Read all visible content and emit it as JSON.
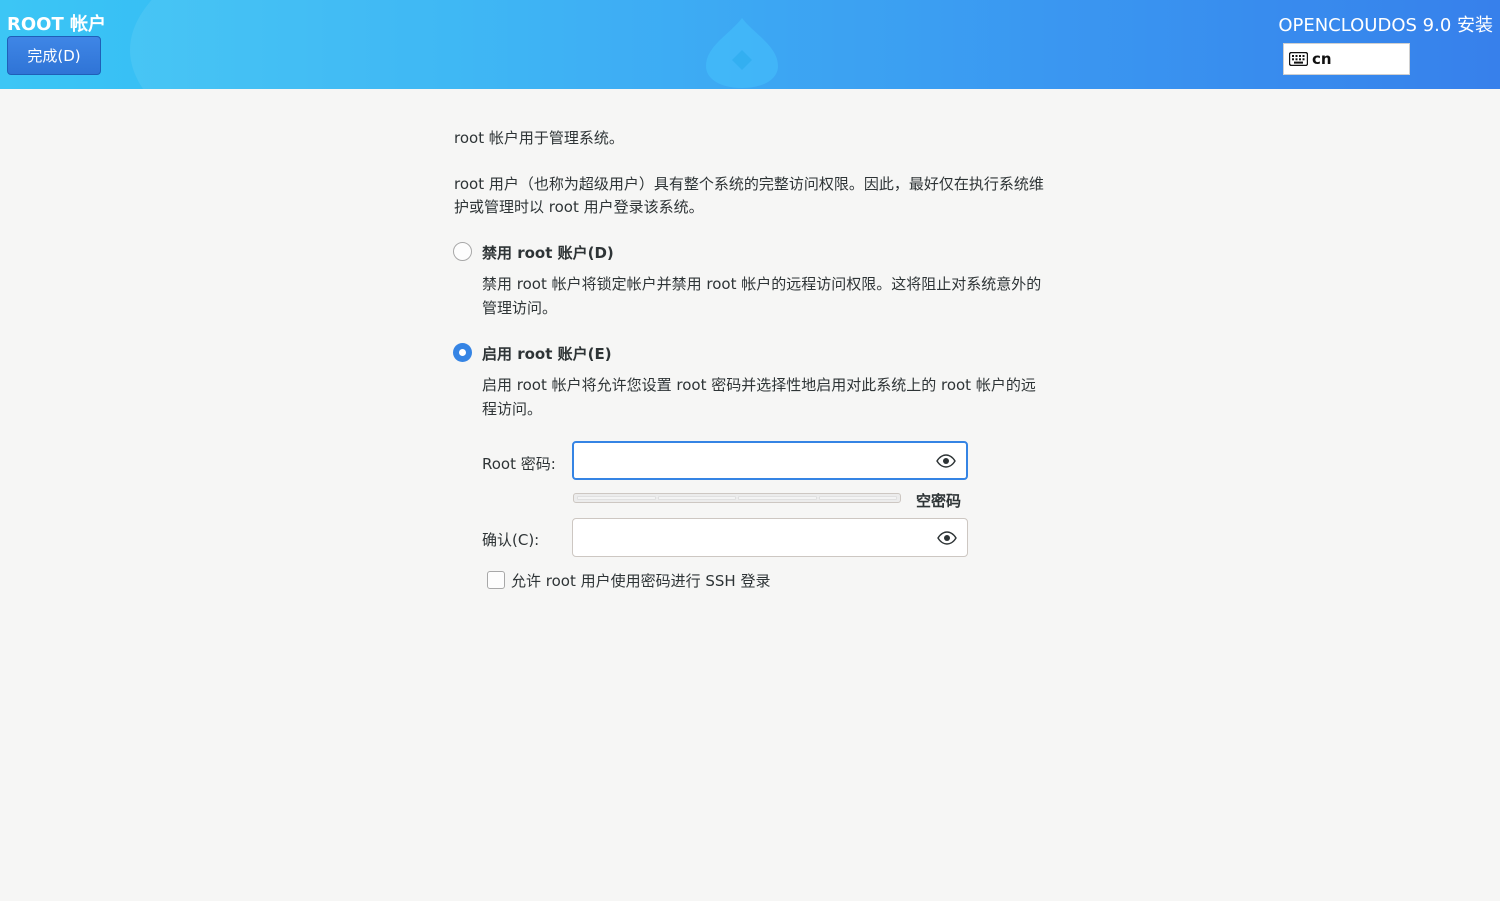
{
  "header": {
    "spoke_title": "ROOT 帐户",
    "done_label": "完成(D)",
    "product_title": "OPENCLOUDOS 9.0 安装",
    "keyboard_layout": "cn"
  },
  "intro": {
    "line1": "root 帐户用于管理系统。",
    "line2a": "root 用户（也称为超级用户）具有整个系统的完整访问权限。因此，最好仅在执行系统维",
    "line2b": "护或管理时以 root 用户登录该系统。"
  },
  "options": {
    "disable": {
      "label": "禁用 root 账户(D)",
      "desc_a": "禁用 root 帐户将锁定帐户并禁用 root 帐户的远程访问权限。这将阻止对系统意外的",
      "desc_b": "管理访问。",
      "selected": false
    },
    "enable": {
      "label": "启用 root 账户(E)",
      "desc_a": "启用 root 帐户将允许您设置 root 密码并选择性地启用对此系统上的 root 帐户的远",
      "desc_b": "程访问。",
      "selected": true
    }
  },
  "form": {
    "password_label": "Root 密码:",
    "password_value": "",
    "strength_label": "空密码",
    "strength_level": 0,
    "confirm_label": "确认(C):",
    "confirm_value": "",
    "ssh_label": "允许 root 用户使用密码进行 SSH 登录",
    "ssh_checked": false
  },
  "colors": {
    "accent": "#3584e4",
    "header_start": "#3cc6f5",
    "header_end": "#2676ea"
  },
  "icons": {
    "keyboard": "keyboard-icon",
    "reveal": "eye-icon"
  }
}
